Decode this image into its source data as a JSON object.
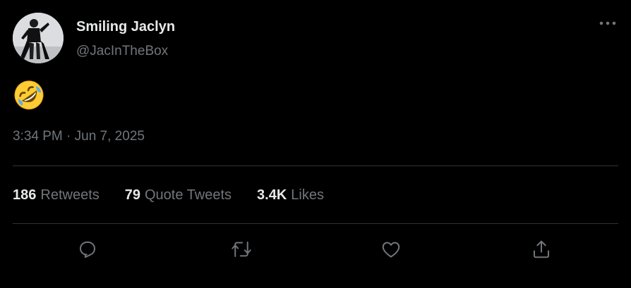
{
  "author": {
    "display_name": "Smiling Jaclyn",
    "handle": "@JacInTheBox"
  },
  "tweet": {
    "emoji_icon": "rolling-on-the-floor-laughing-icon",
    "timestamp": "3:34 PM · Jun 7, 2025"
  },
  "stats": {
    "retweets_count": "186",
    "retweets_label": "Retweets",
    "quotes_count": "79",
    "quotes_label": "Quote Tweets",
    "likes_count": "3.4K",
    "likes_label": "Likes"
  },
  "icons": {
    "more": "more-horizontal-icon",
    "reply": "reply-icon",
    "retweet": "retweet-icon",
    "like": "heart-icon",
    "share": "share-icon"
  },
  "colors": {
    "background": "#000000",
    "primary_text": "#e7e9ea",
    "secondary_text": "#71767b",
    "divider": "#2f3336"
  }
}
